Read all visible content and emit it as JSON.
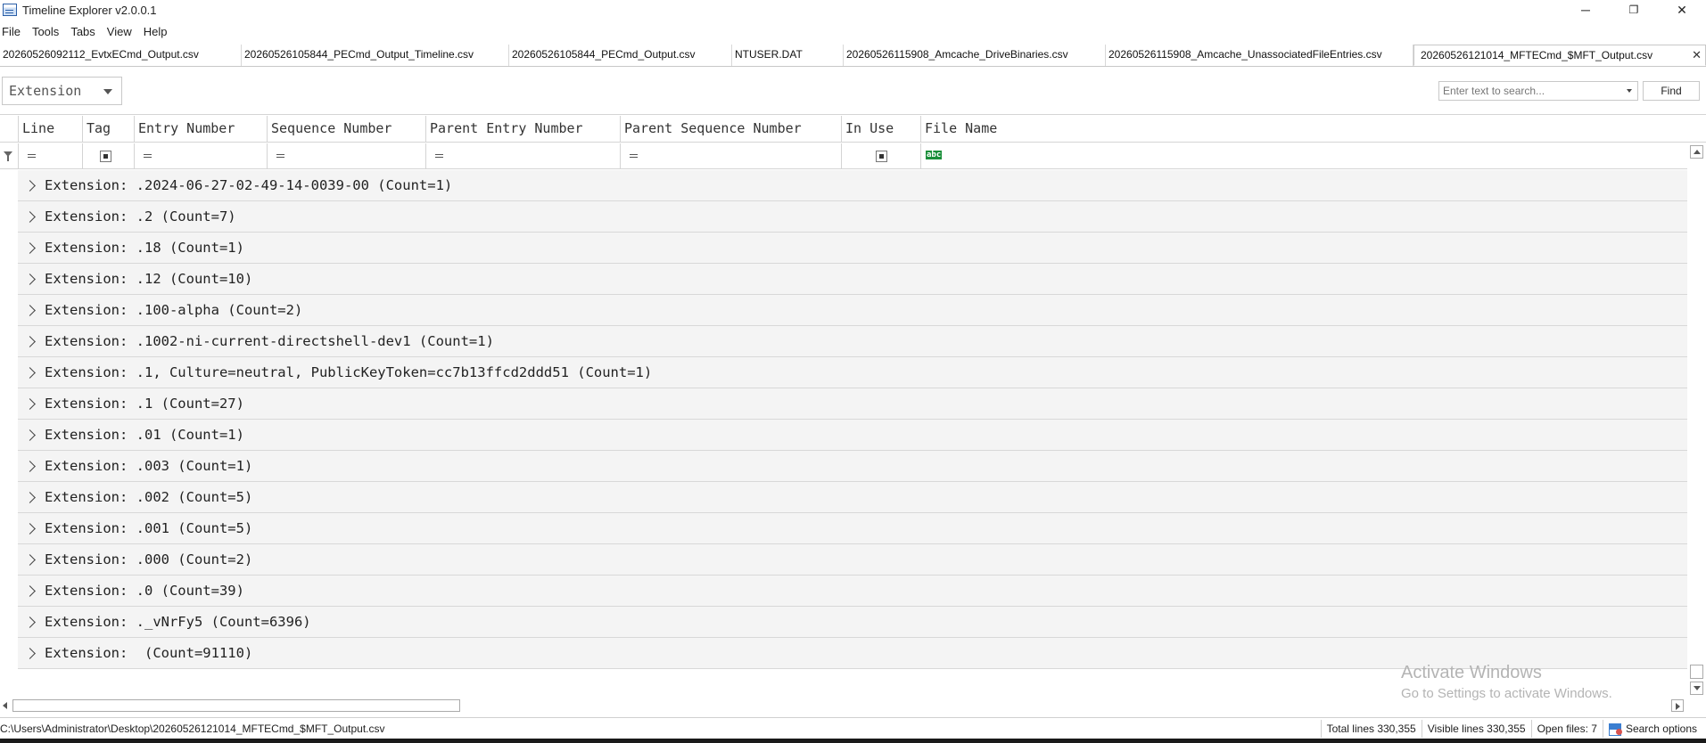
{
  "window": {
    "title": "Timeline Explorer v2.0.0.1",
    "minimize": "─",
    "restore": "❐",
    "close": "✕"
  },
  "menu": [
    "File",
    "Tools",
    "Tabs",
    "View",
    "Help"
  ],
  "tabs": [
    {
      "label": "20260526092112_EvtxECmd_Output.csv",
      "active": false
    },
    {
      "label": "20260526105844_PECmd_Output_Timeline.csv",
      "active": false
    },
    {
      "label": "20260526105844_PECmd_Output.csv",
      "active": false
    },
    {
      "label": "NTUSER.DAT",
      "active": false
    },
    {
      "label": "20260526115908_Amcache_DriveBinaries.csv",
      "active": false
    },
    {
      "label": "20260526115908_Amcache_UnassociatedFileEntries.csv",
      "active": false
    },
    {
      "label": "20260526121014_MFTECmd_$MFT_Output.csv",
      "active": true
    }
  ],
  "tab_close": "✕",
  "toolbar": {
    "group_by": "Extension",
    "search_placeholder": "Enter text to search...",
    "find_label": "Find"
  },
  "columns": [
    "Line",
    "Tag",
    "Entry Number",
    "Sequence Number",
    "Parent Entry Number",
    "Parent Sequence Number",
    "In Use",
    "File Name"
  ],
  "filter_icons": {
    "file_name": "abc"
  },
  "groups": [
    "Extension: .2024-06-27-02-49-14-0039-00 (Count=1)",
    "Extension: .2 (Count=7)",
    "Extension: .18 (Count=1)",
    "Extension: .12 (Count=10)",
    "Extension: .100-alpha (Count=2)",
    "Extension: .1002-ni-current-directshell-dev1 (Count=1)",
    "Extension: .1, Culture=neutral, PublicKeyToken=cc7b13ffcd2ddd51 (Count=1)",
    "Extension: .1 (Count=27)",
    "Extension: .01 (Count=1)",
    "Extension: .003 (Count=1)",
    "Extension: .002 (Count=5)",
    "Extension: .001 (Count=5)",
    "Extension: .000 (Count=2)",
    "Extension: .0 (Count=39)",
    "Extension: ._vNrFy5 (Count=6396)",
    "Extension:  (Count=91110)"
  ],
  "watermark": {
    "line1": "Activate Windows",
    "line2": "Go to Settings to activate Windows."
  },
  "status": {
    "path": "C:\\Users\\Administrator\\Desktop\\20260526121014_MFTECmd_$MFT_Output.csv",
    "total_lines": "Total lines 330,355",
    "visible_lines": "Visible lines 330,355",
    "open_files": "Open files: 7",
    "search_options": "Search options"
  }
}
